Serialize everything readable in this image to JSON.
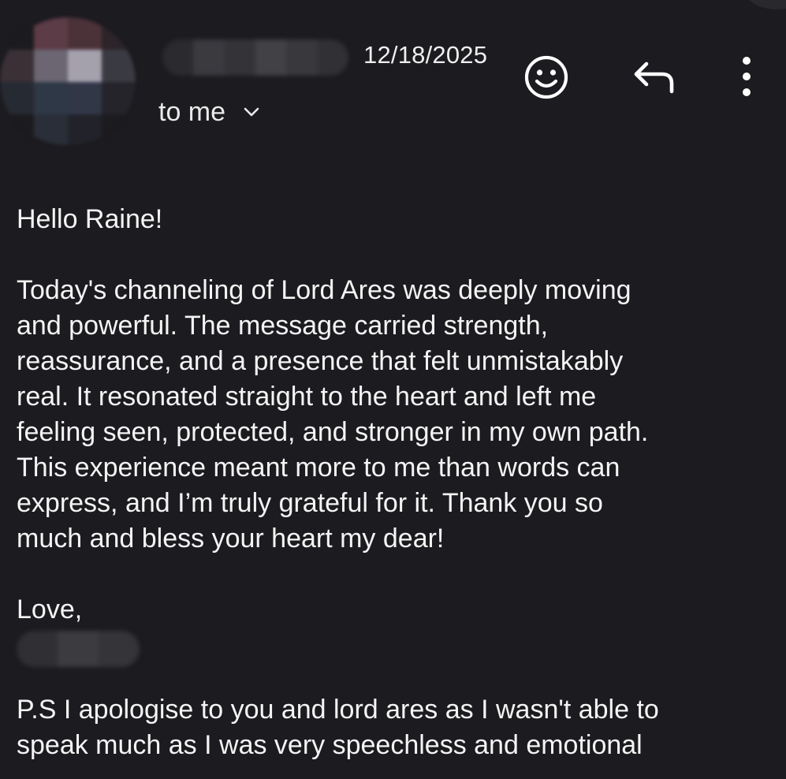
{
  "header": {
    "date": "12/18/2025",
    "recipient_label": "to me"
  },
  "icons": {
    "avatar": "redacted-avatar",
    "emoji": "smiley-face-icon",
    "reply": "reply-arrow-icon",
    "more": "more-vert-icon",
    "chevron": "chevron-down-icon"
  },
  "colors": {
    "background": "#1c1b1f",
    "text": "#f1f1f1"
  },
  "message": {
    "greeting": "Hello Raine!",
    "paragraph": "Today's channeling of Lord Ares was deeply moving\nand powerful. The message carried strength,\nreassurance, and a presence that felt unmistakably\nreal. It resonated straight to the heart and left me\nfeeling seen, protected, and stronger in my own path.\nThis experience meant more to me than words can\nexpress, and I’m truly grateful for it. Thank you so\nmuch and bless your heart my dear!",
    "closing": "Love,",
    "postscript": "P.S I apologise to you and lord ares as I wasn't able to\nspeak much as I was very speechless and emotional"
  }
}
